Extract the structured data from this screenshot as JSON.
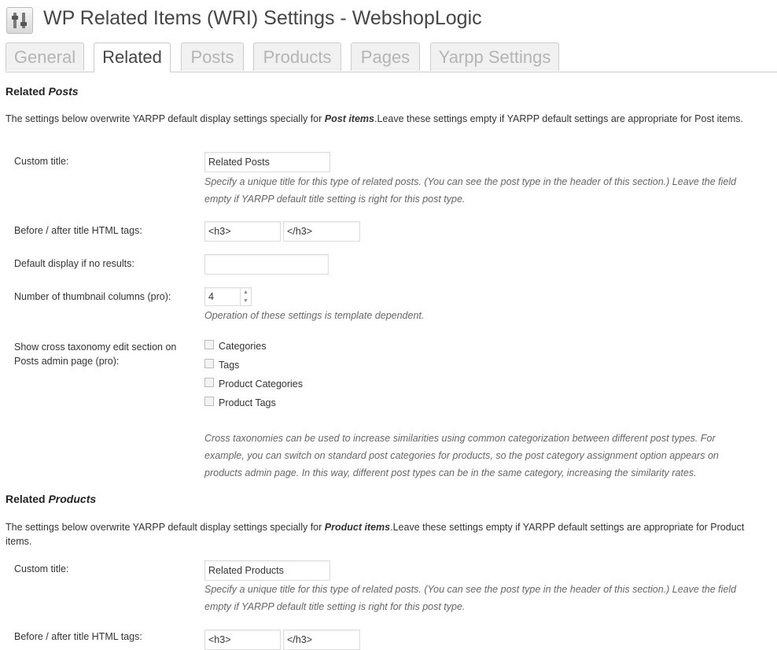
{
  "header": {
    "title": "WP Related Items (WRI) Settings - WebshopLogic",
    "icon": "settings-sliders-icon"
  },
  "tabs": [
    {
      "label": "General",
      "active": false
    },
    {
      "label": "Related",
      "active": true
    },
    {
      "label": "Posts",
      "active": false
    },
    {
      "label": "Products",
      "active": false
    },
    {
      "label": "Pages",
      "active": false
    },
    {
      "label": "Yarpp Settings",
      "active": false
    }
  ],
  "sections": {
    "posts": {
      "heading_prefix": "Related ",
      "heading_em": "Posts",
      "desc_pre": "The settings below overwrite YARPP default display settings specially for ",
      "desc_bold": "Post items",
      "desc_post": ".Leave these settings empty if YARPP default settings are appropriate for Post items.",
      "custom_title_label": "Custom title:",
      "custom_title_value": "Related Posts",
      "custom_title_hint": "Specify a unique title for this type of related posts. (You can see the post type in the header of this section.) Leave the field empty if YARPP default title setting is right for this post type.",
      "tags_label": "Before / after title HTML tags:",
      "before_tag": "<h3>",
      "after_tag": "</h3>",
      "no_results_label": "Default display if no results:",
      "no_results_value": "",
      "columns_label": "Number of thumbnail columns (pro):",
      "columns_value": "4",
      "columns_hint": "Operation of these settings is template dependent.",
      "cross_label": "Show cross taxonomy edit section on Posts admin page (pro):",
      "taxonomies": [
        {
          "label": "Categories",
          "checked": false
        },
        {
          "label": "Tags",
          "checked": false
        },
        {
          "label": "Product Categories",
          "checked": false
        },
        {
          "label": "Product Tags",
          "checked": false
        }
      ],
      "cross_hint": "Cross taxonomies can be used to increase similarities using common categorization between different post types. For example, you can switch on standard post categories for products, so the post category assignment option appears on products admin page. In this way, different post types can be in the same category, increasing the similarity rates."
    },
    "products": {
      "heading_prefix": "Related ",
      "heading_em": "Products",
      "desc_pre": "The settings below overwrite YARPP default display settings specially for ",
      "desc_bold": "Product items",
      "desc_post": ".Leave these settings empty if YARPP default settings are appropriate for Product items.",
      "custom_title_label": "Custom title:",
      "custom_title_value": "Related Products",
      "custom_title_hint": "Specify a unique title for this type of related posts. (You can see the post type in the header of this section.) Leave the field empty if YARPP default title setting is right for this post type.",
      "tags_label": "Before / after title HTML tags:",
      "before_tag": "<h3>",
      "after_tag": "</h3>"
    }
  }
}
